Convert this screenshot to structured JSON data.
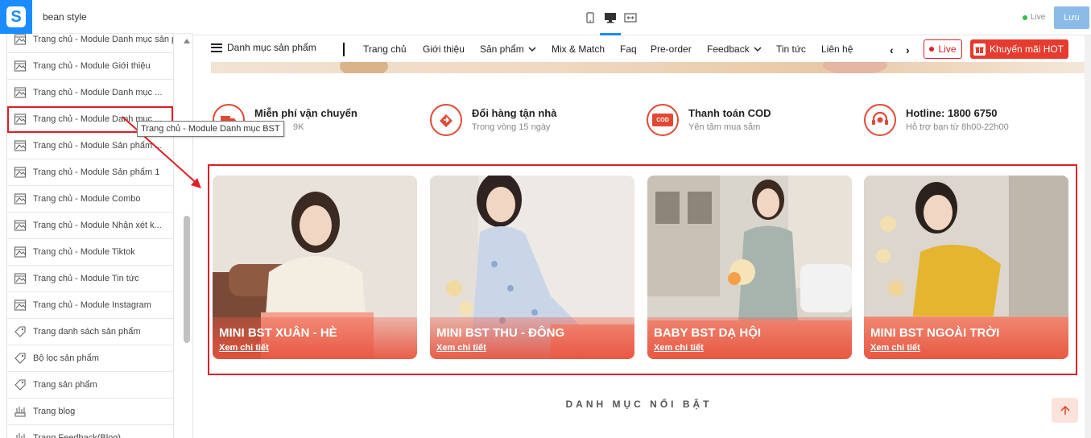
{
  "app": {
    "logo_letter": "S",
    "store_name": "bean style",
    "live_status": "Live",
    "save_label": "Lưu",
    "accent_color": "#1a8cff",
    "highlight_color": "#e01e25"
  },
  "sidebar": {
    "tooltip": "Trang chủ - Module Danh mục BST",
    "items": [
      {
        "label": "Trang chủ - Module Danh mục sản phẩm",
        "icon": "layout-icon"
      },
      {
        "label": "Trang chủ - Module Giới thiệu",
        "icon": "layout-icon"
      },
      {
        "label": "Trang chủ - Module Danh mục ...",
        "icon": "layout-icon"
      },
      {
        "label": "Trang chủ - Module Danh mục ...",
        "icon": "layout-icon",
        "selected": true
      },
      {
        "label": "Trang chủ - Module Sản phẩm ...",
        "icon": "layout-icon"
      },
      {
        "label": "Trang chủ - Module Sản phẩm 1",
        "icon": "layout-icon"
      },
      {
        "label": "Trang chủ - Module Combo",
        "icon": "layout-icon"
      },
      {
        "label": "Trang chủ - Module Nhận xét k...",
        "icon": "layout-icon"
      },
      {
        "label": "Trang chủ - Module Tiktok",
        "icon": "layout-icon"
      },
      {
        "label": "Trang chủ - Module Tin tức",
        "icon": "layout-icon"
      },
      {
        "label": "Trang chủ - Module Instagram",
        "icon": "layout-icon"
      },
      {
        "label": "Trang danh sách sản phẩm",
        "icon": "tag-icon"
      },
      {
        "label": "Bộ lọc sản phẩm",
        "icon": "tag-icon"
      },
      {
        "label": "Trang sản phẩm",
        "icon": "tag-icon"
      },
      {
        "label": "Trang blog",
        "icon": "blog-icon"
      },
      {
        "label": "Trang Feedback(Blog)",
        "icon": "blog-icon"
      }
    ]
  },
  "topbar": {
    "devices": [
      "mobile-icon",
      "desktop-icon",
      "fullscreen-icon"
    ],
    "active_device": "desktop-icon"
  },
  "store_nav": {
    "category_menu": "Danh mục sản phẩm",
    "links": [
      {
        "label": "Trang chủ"
      },
      {
        "label": "Giới thiệu"
      },
      {
        "label": "Sản phẩm",
        "dropdown": true
      },
      {
        "label": "Mix & Match"
      },
      {
        "label": "Faq"
      },
      {
        "label": "Pre-order"
      },
      {
        "label": "Feedback",
        "dropdown": true
      },
      {
        "label": "Tin tức"
      },
      {
        "label": "Liên hệ"
      }
    ],
    "prev_arrow": "‹",
    "next_arrow": "›",
    "live_label": "Live",
    "promo_label": "Khuyến mãi HOT"
  },
  "features": [
    {
      "title": "Miễn phí vận chuyển",
      "subtitle": "9K",
      "icon": "truck-icon"
    },
    {
      "title": "Đổi hàng tận nhà",
      "subtitle": "Trong vòng 15 ngày",
      "icon": "exchange-icon"
    },
    {
      "title": "Thanh toán COD",
      "subtitle": "Yên tâm mua sắm",
      "icon": "cod-icon",
      "icon_text": "COD"
    },
    {
      "title": "Hotline: 1800 6750",
      "subtitle": "Hỗ trợ bạn từ 8h00-22h00",
      "icon": "headset-icon"
    }
  ],
  "collections": [
    {
      "title": "MINI BST XUÂN - HÈ",
      "link": "Xem chi tiết"
    },
    {
      "title": "MINI BST THU - ĐÔNG",
      "link": "Xem chi tiết"
    },
    {
      "title": "BABY BST DẠ HỘI",
      "link": "Xem chi tiết"
    },
    {
      "title": "MINI BST NGOÀI TRỜI",
      "link": "Xem chi tiết"
    }
  ],
  "section_heading": "DANH MỤC NỔI BẬT"
}
